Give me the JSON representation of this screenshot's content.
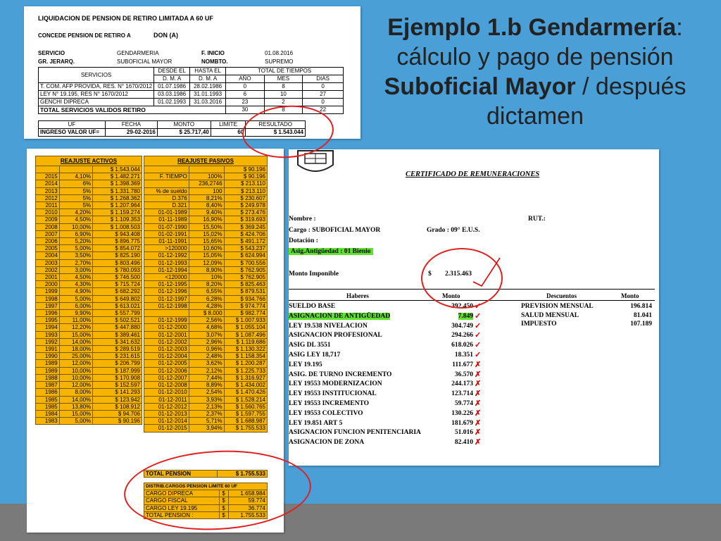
{
  "title": {
    "line1_bold": "Ejemplo 1.b Gendarmería",
    "line1_tail": ":",
    "line2": "cálculo y pago de pensión",
    "line3_bold": "Suboficial Mayor",
    "line3_tail": " / después",
    "line4": "dictamen"
  },
  "liquidacion": {
    "heading": "LIQUIDACION DE PENSION DE RETIRO LIMITADA A 60 UF",
    "concede_label": "CONCEDE PENSION DE RETIRO A",
    "concede_value": "DON (A)",
    "servicio_label": "SERVICIO",
    "servicio_value": "GENDARMERIA",
    "finicio_label": "F. INICIO",
    "finicio_value": "01.08.2016",
    "grjerarq_label": "GR. JERARQ.",
    "grjerarq_value": "SUBOFICIAL MAYOR",
    "nombto_label": "NOMBTO.",
    "nombto_value": "SUPREMO",
    "h_servicios": "SERVICIOS",
    "h_desde": "DESDE EL",
    "h_hasta": "HASTA EL",
    "h_dma": "D. M. A",
    "h_total": "TOTAL DE TIEMPOS",
    "h_ano": "AÑO",
    "h_mes": "MES",
    "h_dias": "DIAS",
    "rows": [
      [
        "T. COM. AFP PROVIDA, RES. N° 1670/2012",
        "01.07.1986",
        "28.02.1986",
        "0",
        "8",
        "0"
      ],
      [
        "LEY N° 19.195, RES N° 1670/2012",
        "03.03.1986",
        "31.01.1993",
        "6",
        "10",
        "27"
      ],
      [
        "GENCHI DIPRECA",
        "01.02.1993",
        "31.03.2016",
        "23",
        "2",
        "0"
      ]
    ],
    "total_label": "TOTAL SERVICIOS VALIDOS RETIRO",
    "total_ano": "30",
    "total_mes": "8",
    "total_dias": "22",
    "h_uf": "UF",
    "h_fecha": "FECHA",
    "h_monto": "MONTO",
    "h_limite": "LIMITE",
    "h_resultado": "RESULTADO",
    "ingreso_label": "INGRESO VALOR UF=",
    "fecha": "29-02-2016",
    "monto": "$ 25.717,40",
    "limite": "60",
    "resultado": "$ 1.543.044"
  },
  "reajuste": {
    "activos_title": "REAJUSTE ACTIVOS",
    "pasivos_title": "REAJUSTE PASIVOS",
    "activos": [
      [
        "",
        "",
        "$ 1.543.044"
      ],
      [
        "2015",
        "4,10%",
        "$ 1.482.271"
      ],
      [
        "2014",
        "6%",
        "$ 1.398.369"
      ],
      [
        "2013",
        "5%",
        "$ 1.331.780"
      ],
      [
        "2012",
        "5%",
        "$ 1.268.362"
      ],
      [
        "2011",
        "5%",
        "$ 1.207.964"
      ],
      [
        "2010",
        "4,20%",
        "$ 1.159.274"
      ],
      [
        "2009",
        "4,50%",
        "$ 1.109.353"
      ],
      [
        "2008",
        "10,00%",
        "$ 1.008.503"
      ],
      [
        "2007",
        "6,90%",
        "$ 943.408"
      ],
      [
        "2006",
        "5,20%",
        "$ 896.775"
      ],
      [
        "2005",
        "5,00%",
        "$ 854.072"
      ],
      [
        "2004",
        "3,50%",
        "$ 825.190"
      ],
      [
        "2003",
        "2,70%",
        "$ 803.496"
      ],
      [
        "2002",
        "3,00%",
        "$ 780.093"
      ],
      [
        "2001",
        "4,50%",
        "$ 746.500"
      ],
      [
        "2000",
        "4,30%",
        "$ 715.724"
      ],
      [
        "1999",
        "4,90%",
        "$ 682.292"
      ],
      [
        "1998",
        "5,00%",
        "$ 649.802"
      ],
      [
        "1997",
        "6,00%",
        "$ 613.021"
      ],
      [
        "1996",
        "9,90%",
        "$ 557.799"
      ],
      [
        "1995",
        "11,00%",
        "$ 502.521"
      ],
      [
        "1994",
        "12,20%",
        "$ 447.880"
      ],
      [
        "1993",
        "15,00%",
        "$ 389.461"
      ],
      [
        "1992",
        "14,00%",
        "$ 341.632"
      ],
      [
        "1991",
        "18,00%",
        "$ 289.519"
      ],
      [
        "1990",
        "25,00%",
        "$ 231.615"
      ],
      [
        "1989",
        "12,00%",
        "$ 206.799"
      ],
      [
        "1989",
        "10,00%",
        "$ 187.999"
      ],
      [
        "1988",
        "10,00%",
        "$ 170.908"
      ],
      [
        "1987",
        "12,00%",
        "$ 152.597"
      ],
      [
        "1986",
        "8,00%",
        "$ 141.293"
      ],
      [
        "1985",
        "14,00%",
        "$ 123.942"
      ],
      [
        "1985",
        "13,80%",
        "$ 108.912"
      ],
      [
        "1984",
        "15,00%",
        "$ 94.706"
      ],
      [
        "1983",
        "5,00%",
        "$ 90.196"
      ]
    ],
    "pasivos": [
      [
        "",
        "",
        "$ 90.196"
      ],
      [
        "F. TIEMPO",
        "100%",
        "$ 90.196"
      ],
      [
        "",
        "236,2746",
        "$ 213.110"
      ],
      [
        "% de sueldo",
        "100",
        "$ 213.110"
      ],
      [
        "D.376",
        "8,21%",
        "$ 230.607"
      ],
      [
        "D.321",
        "8,40%",
        "$ 249.978"
      ],
      [
        "01-01-1989",
        "9,40%",
        "$ 273.476"
      ],
      [
        "01-11-1989",
        "16,90%",
        "$ 319.693"
      ],
      [
        "01-07-1990",
        "15,50%",
        "$ 369.245"
      ],
      [
        "01-02-1991",
        "15,02%",
        "$ 424.706"
      ],
      [
        "01-11-1991",
        "15,65%",
        "$ 491.172"
      ],
      [
        ">120000",
        "10,60%",
        "$ 543.237"
      ],
      [
        "01-12-1992",
        "15,05%",
        "$ 624.994"
      ],
      [
        "01-12-1993",
        "12,09%",
        "$ 700.556"
      ],
      [
        "01-12-1994",
        "8,90%",
        "$ 762.905"
      ],
      [
        "<120000",
        "10%",
        "$ 762.905"
      ],
      [
        "01-12-1995",
        "8,20%",
        "$ 825.463"
      ],
      [
        "01-12-1996",
        "6,55%",
        "$ 879.531"
      ],
      [
        "01-12-1997",
        "6,28%",
        "$ 934.766"
      ],
      [
        "01-12-1998",
        "4,28%",
        "$ 974.774"
      ],
      [
        "",
        "$ 8.000",
        "$ 982.774"
      ],
      [
        "01-12-1999",
        "2,56%",
        "$ 1.007.933"
      ],
      [
        "01-12-2000",
        "4,68%",
        "$ 1.055.104"
      ],
      [
        "01-12-2001",
        "3,07%",
        "$ 1.087.496"
      ],
      [
        "01-12-2002",
        "2,96%",
        "$ 1.119.686"
      ],
      [
        "01-12-2003",
        "0,96%",
        "$ 1.130.322"
      ],
      [
        "01-12-2004",
        "2,48%",
        "$ 1.158.354"
      ],
      [
        "01-12-2005",
        "3,62%",
        "$ 1.200.287"
      ],
      [
        "01-12-2006",
        "2,12%",
        "$ 1.225.733"
      ],
      [
        "01-12-2007",
        "7,44%",
        "$ 1.316.927"
      ],
      [
        "01-12-2008",
        "8,89%",
        "$ 1.434.002"
      ],
      [
        "01-12-2010",
        "2,54%",
        "$ 1.470.426"
      ],
      [
        "01-12-2011",
        "3,93%",
        "$ 1.528.214"
      ],
      [
        "01-12-2012",
        "2,13%",
        "$ 1.560.765"
      ],
      [
        "01-12-2013",
        "2,37%",
        "$ 1.597.755"
      ],
      [
        "01-12-2014",
        "5,71%",
        "$ 1.688.987"
      ],
      [
        "01-12-2015",
        "3,94%",
        "$ 1.755.533"
      ]
    ],
    "total_label": "TOTAL PENSION",
    "total_value": "$ 1.755.533",
    "distrib_title": "DISTRIB.CARGOS PENSION LIMITE 60 UF",
    "distrib": [
      [
        "CARGO DIPRECA",
        "$",
        "1.658.984"
      ],
      [
        "CARGO FISCAL",
        "$",
        "59.774"
      ],
      [
        "CARGO LEY 19.195",
        "$",
        "36.774"
      ],
      [
        "TOTAL PENSION :",
        "$",
        "1.755.533"
      ]
    ]
  },
  "certificado": {
    "title": "CERTIFICADO DE REMUNERACIONES",
    "nombre": "Nombre :",
    "rut": "RUT.:",
    "cargo": "Cargo : SUBOFICIAL MAYOR",
    "grado": "Grado : 09° E.U.S.",
    "dotacion": "Dotación :",
    "asig": "Asig.Antigüedad : 01 Bienio",
    "monto_imponible_label": "Monto Imponible",
    "monto_imponible_currency": "$",
    "monto_imponible_value": "2.315.463",
    "h_haberes": "Haberes",
    "h_monto": "Monto",
    "h_descuentos": "Descuentos",
    "h_monto2": "Monto",
    "haberes": [
      [
        "SUELDO BASE",
        "392.450"
      ],
      [
        "ASIGNACION DE ANTIGÜEDAD",
        "7.849"
      ],
      [
        "LEY 19.538 NIVELACION",
        "304.749"
      ],
      [
        "ASIGNACION PROFESIONAL",
        "294.266"
      ],
      [
        "ASIG DL 3551",
        "618.026"
      ],
      [
        "ASIG LEY 18,717",
        "18.351"
      ],
      [
        "LEY 19.195",
        "111.677"
      ],
      [
        "ASIG. DE TURNO INCREMENTO",
        "36.570"
      ],
      [
        "LEY 19553 MODERNIZACION",
        "244.173"
      ],
      [
        "LEY 19553 INSTITUCIONAL",
        "123.714"
      ],
      [
        "LEY 19553 INCREMENTO",
        "59.774"
      ],
      [
        "LEY 19553 COLECTIVO",
        "130.226"
      ],
      [
        "LEY 19.851 ART 5",
        "181.679"
      ],
      [
        "ASIGNACION FUNCION PENITENCIARIA",
        "51.016"
      ],
      [
        "ASIGNACION DE ZONA",
        "82.410"
      ]
    ],
    "descuentos": [
      [
        "PREVISION MENSUAL",
        "196.814"
      ],
      [
        "SALUD MENSUAL",
        "81.041"
      ],
      [
        "IMPUESTO",
        "107.189"
      ]
    ]
  },
  "colors": {
    "background": "#4a9fd6",
    "table_yellow": "#f6b300",
    "highlight": "#5fe02a",
    "annotation_red": "#e02020"
  }
}
